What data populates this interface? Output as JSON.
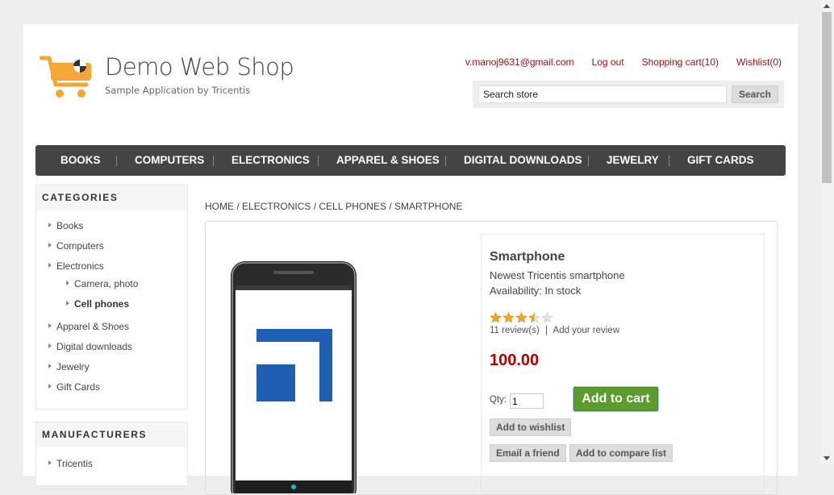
{
  "header": {
    "title": "Demo Web Shop",
    "subtitle": "Sample Application by Tricentis",
    "links": {
      "account": "v.manoj9631@gmail.com",
      "logout": "Log out",
      "cart": "Shopping cart(10)",
      "wishlist": "Wishlist(0)"
    },
    "search": {
      "value": "Search store",
      "button": "Search"
    }
  },
  "menu": [
    "BOOKS",
    "COMPUTERS",
    "ELECTRONICS",
    "APPAREL & SHOES",
    "DIGITAL DOWNLOADS",
    "JEWELRY",
    "GIFT CARDS"
  ],
  "categories": {
    "title": "CATEGORIES",
    "items": [
      "Books",
      "Computers",
      "Electronics",
      "Camera, photo",
      "Cell phones",
      "Apparel & Shoes",
      "Digital downloads",
      "Jewelry",
      "Gift Cards"
    ]
  },
  "manufacturers": {
    "title": "MANUFACTURERS",
    "items": [
      "Tricentis"
    ]
  },
  "breadcrumb": [
    "HOME",
    "ELECTRONICS",
    "CELL PHONES",
    "SMARTPHONE"
  ],
  "product": {
    "name": "Smartphone",
    "description": "Newest Tricentis smartphone",
    "availability": "Availability: In stock",
    "rating": 3.5,
    "rating_max": 5,
    "reviews": "11 review(s)",
    "review_sep": "|",
    "add_review": "Add your review",
    "price": "100.00",
    "qty_label": "Qty:",
    "qty": "1",
    "add_to_cart": "Add to cart",
    "add_to_wishlist": "Add to wishlist",
    "email_friend": "Email a friend",
    "add_to_compare": "Add to compare list"
  },
  "colors": {
    "link_red": "#a01010",
    "price_red": "#b10000",
    "menu_bg": "#444444",
    "cart_green": "#5b9c2a",
    "logo_orange": "#f4a636",
    "star_gold": "#f5a623"
  }
}
